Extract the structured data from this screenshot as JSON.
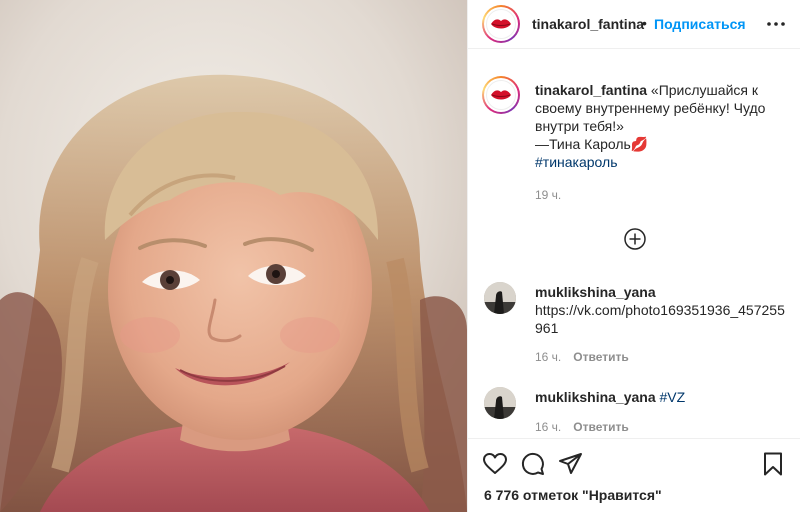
{
  "header": {
    "username": "tinakarol_fantina",
    "separator": "•",
    "follow_label": "Подписаться",
    "avatar_icon": "lips-icon",
    "more_icon": "more-icon"
  },
  "caption": {
    "username": "tinakarol_fantina",
    "text": "«Прислушайся к своему внутреннему ребёнку! Чудо внутри тебя!»",
    "signature": "—Тина Кароль",
    "emoji": "💋",
    "hashtag": "#тинакароль",
    "time": "19 ч."
  },
  "load_more_icon": "plus-circle-icon",
  "comments": [
    {
      "username": "muklikshina_yana",
      "text": "https://vk.com/photo169351936_457255961",
      "time": "16 ч.",
      "reply_label": "Ответить"
    },
    {
      "username": "muklikshina_yana",
      "text": "#VZ",
      "time": "16 ч.",
      "reply_label": "Ответить"
    }
  ],
  "actions": {
    "like_icon": "heart-icon",
    "comment_icon": "comment-icon",
    "share_icon": "send-icon",
    "save_icon": "bookmark-icon",
    "likes_text": "6 776 отметок \"Нравится\""
  },
  "colors": {
    "link": "#0095f6",
    "hashtag": "#00376b",
    "meta": "#8e8e8e",
    "text": "#262626"
  }
}
